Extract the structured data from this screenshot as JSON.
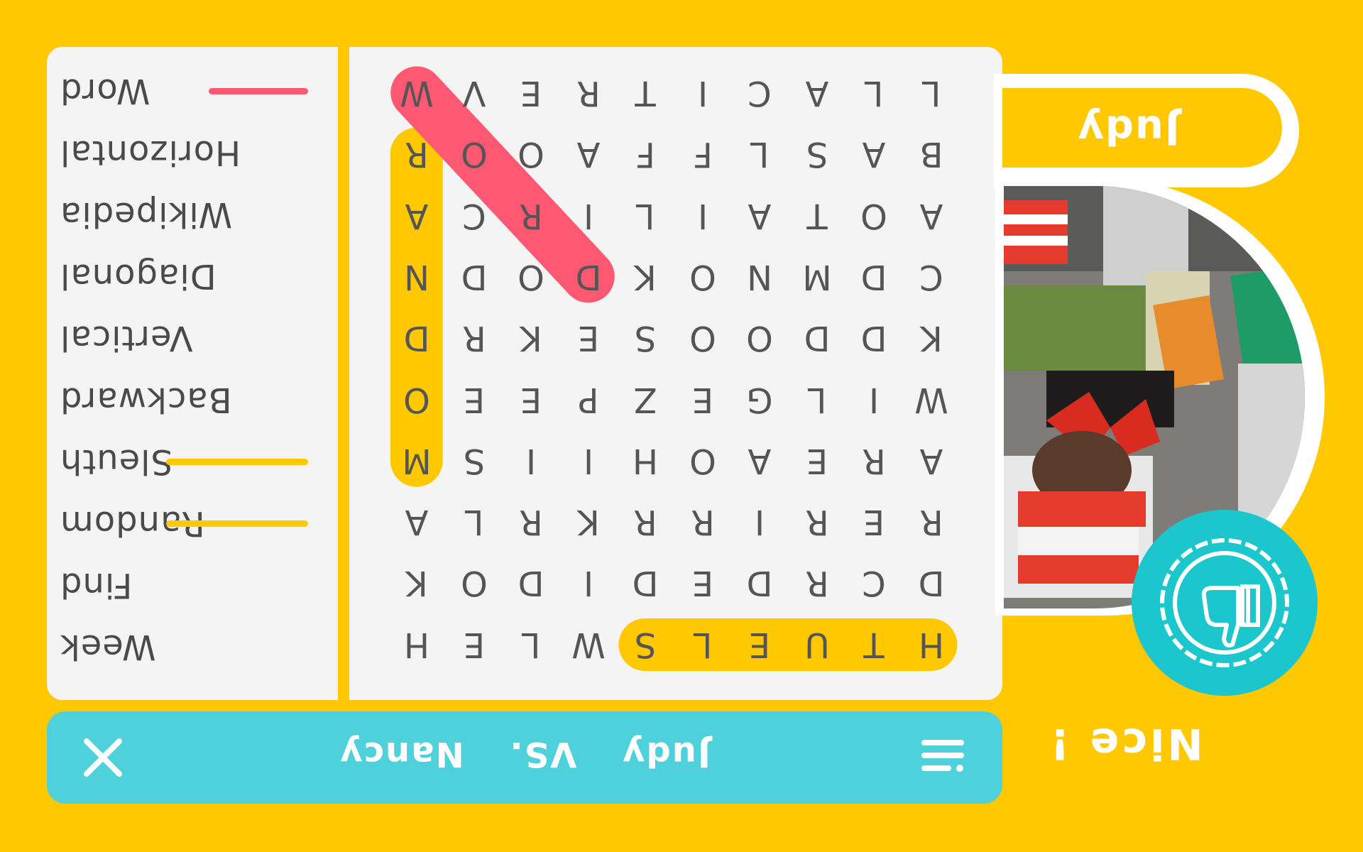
{
  "word_list": [
    {
      "text": "Word",
      "found": true,
      "strike_color": "#FF5872"
    },
    {
      "text": "Horizontal",
      "found": false
    },
    {
      "text": "Wikipedia",
      "found": false
    },
    {
      "text": "Diagonal",
      "found": false
    },
    {
      "text": "Vertical",
      "found": false
    },
    {
      "text": "Backward",
      "found": false
    },
    {
      "text": "Sleuth",
      "found": true,
      "strike_color": "#FFC800"
    },
    {
      "text": "Random",
      "found": true,
      "strike_color": "#FFC800"
    },
    {
      "text": "Find",
      "found": false
    },
    {
      "text": "Week",
      "found": false
    }
  ],
  "grid": [
    [
      "H",
      "T",
      "U",
      "E",
      "L",
      "S",
      "W",
      "L",
      "E",
      "H"
    ],
    [
      "D",
      "C",
      "R",
      "D",
      "E",
      "D",
      "I",
      "D",
      "O",
      "K"
    ],
    [
      "R",
      "E",
      "R",
      "I",
      "R",
      "R",
      "K",
      "R",
      "L",
      "A"
    ],
    [
      "A",
      "R",
      "E",
      "A",
      "O",
      "H",
      "I",
      "I",
      "S",
      "M"
    ],
    [
      "W",
      "I",
      "L",
      "G",
      "E",
      "Z",
      "P",
      "E",
      "E",
      "O"
    ],
    [
      "K",
      "D",
      "D",
      "O",
      "O",
      "S",
      "E",
      "K",
      "R",
      "D"
    ],
    [
      "C",
      "D",
      "M",
      "N",
      "O",
      "K",
      "D",
      "O",
      "D",
      "N"
    ],
    [
      "A",
      "O",
      "T",
      "A",
      "I",
      "L",
      "I",
      "R",
      "C",
      "A"
    ],
    [
      "B",
      "A",
      "S",
      "L",
      "F",
      "F",
      "A",
      "O",
      "O",
      "R"
    ],
    [
      "L",
      "L",
      "A",
      "C",
      "I",
      "T",
      "R",
      "E",
      "V",
      "W"
    ]
  ],
  "found_words": [
    {
      "word": "SLEUTH",
      "color": "#FFC800",
      "from": [
        0,
        0
      ],
      "to": [
        0,
        5
      ]
    },
    {
      "word": "RANDOM",
      "color": "#FFC800",
      "from": [
        3,
        9
      ],
      "to": [
        8,
        9
      ]
    },
    {
      "word": "WORD",
      "color": "#FF5872",
      "from": [
        9,
        9
      ],
      "to": [
        6,
        6
      ]
    }
  ],
  "bottom_bar": {
    "player1": "Judy",
    "vs": "VS.",
    "player2": "Nancy",
    "close_icon": "close-icon",
    "menu_icon": "menu-icon"
  },
  "player": {
    "name": "Judy"
  },
  "badge": {
    "icon": "thumbs-down-icon"
  },
  "feedback": "Nice !",
  "colors": {
    "background": "#FFC800",
    "panel": "#F4F4F4",
    "bar": "#4FD1DC",
    "badge": "#1BC6CC",
    "highlight_yellow": "#FFC800",
    "highlight_pink": "#FF5872"
  }
}
